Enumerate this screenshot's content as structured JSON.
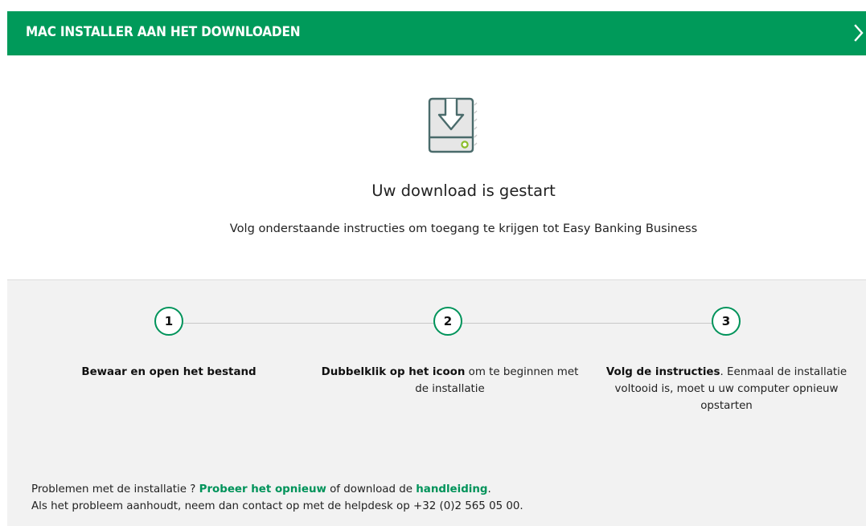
{
  "header": {
    "title": "MAC INSTALLER AAN HET DOWNLOADEN",
    "close_icon": "chevron-right-icon",
    "background_color": "#009a5a"
  },
  "hero": {
    "icon": "download-drive-icon",
    "title": "Uw download is gestart",
    "subtitle": "Volg onderstaande instructies om toegang te krijgen tot Easy Banking Business"
  },
  "steps": [
    {
      "number": "1",
      "bold": "Bewaar en open het bestand",
      "text": ""
    },
    {
      "number": "2",
      "bold": "Dubbelklik op het icoon",
      "text": " om te beginnen met de installatie"
    },
    {
      "number": "3",
      "bold": "Volg de instructies",
      "text": ". Eenmaal de installatie voltooid is, moet u uw computer opnieuw opstarten"
    }
  ],
  "help": {
    "line1_prefix": "Problemen met de installatie ? ",
    "retry_link": "Probeer het opnieuw",
    "line1_middle": " of download de ",
    "manual_link": "handleiding",
    "line1_suffix": ".",
    "line2": "Als het probleem aanhoudt, neem dan contact op met de helpdesk op +32 (0)2 565 05 00."
  },
  "colors": {
    "accent": "#00935a",
    "steps_background": "#f2f2f2"
  }
}
